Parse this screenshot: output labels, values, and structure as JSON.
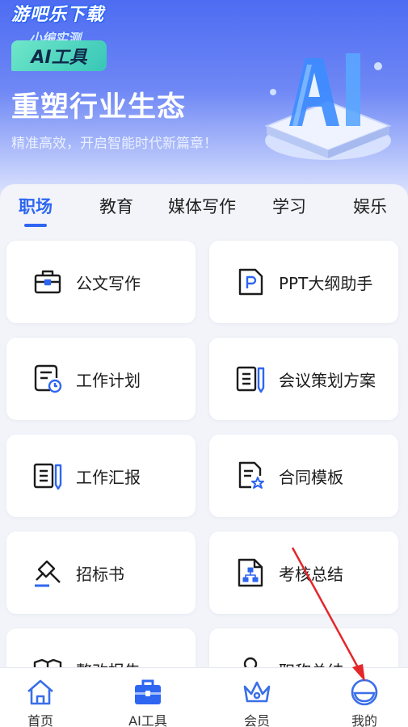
{
  "watermark": {
    "text": "游吧乐下载",
    "sub": "小编实测"
  },
  "hero": {
    "badge": "AI工具",
    "title": "重塑行业生态",
    "subtitle": "精准高效，开启智能时代新篇章！"
  },
  "tabs": [
    {
      "label": "职场",
      "active": true
    },
    {
      "label": "教育",
      "active": false
    },
    {
      "label": "媒体写作",
      "active": false
    },
    {
      "label": "学习",
      "active": false
    },
    {
      "label": "娱乐",
      "active": false
    }
  ],
  "cards": [
    {
      "label": "公文写作",
      "icon": "briefcase-icon"
    },
    {
      "label": "PPT大纲助手",
      "icon": "ppt-file-icon"
    },
    {
      "label": "工作计划",
      "icon": "plan-clock-icon"
    },
    {
      "label": "会议策划方案",
      "icon": "document-pen-icon"
    },
    {
      "label": "工作汇报",
      "icon": "report-pen-icon"
    },
    {
      "label": "合同模板",
      "icon": "contract-star-icon"
    },
    {
      "label": "招标书",
      "icon": "gavel-icon"
    },
    {
      "label": "考核总结",
      "icon": "org-chart-file-icon"
    },
    {
      "label": "整改报告",
      "icon": "folder-report-icon"
    },
    {
      "label": "职称总结",
      "icon": "user-badge-icon"
    }
  ],
  "tabbar": [
    {
      "label": "首页",
      "icon": "home-icon"
    },
    {
      "label": "AI工具",
      "icon": "toolbox-icon"
    },
    {
      "label": "会员",
      "icon": "crown-icon"
    },
    {
      "label": "我的",
      "icon": "profile-icon"
    }
  ],
  "colors": {
    "accent": "#2e66f2",
    "annotation_arrow": "#e5262a"
  }
}
